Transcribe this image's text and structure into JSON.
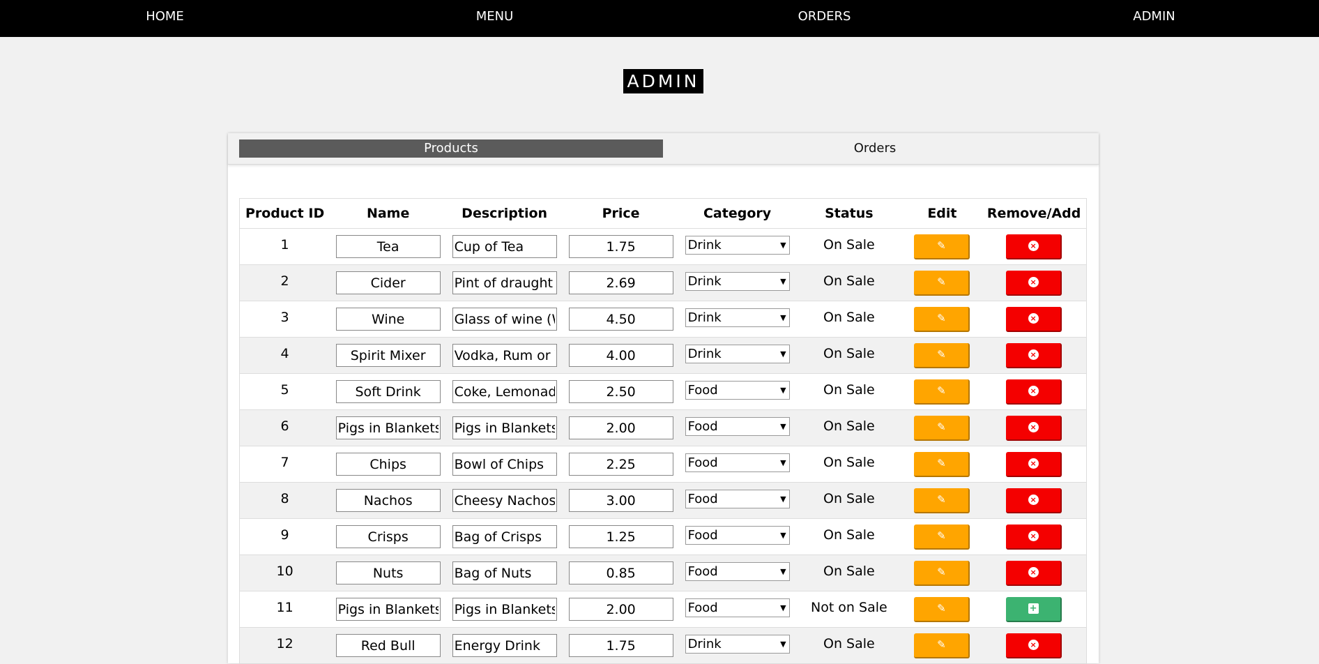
{
  "nav": {
    "home": "HOME",
    "menu": "MENU",
    "orders": "ORDERS",
    "admin": "ADMIN"
  },
  "page": {
    "title": "ADMIN"
  },
  "tabs": {
    "products": "Products",
    "orders": "Orders"
  },
  "table": {
    "headers": [
      "Product ID",
      "Name",
      "Description",
      "Price",
      "Category",
      "Status",
      "Edit",
      "Remove/Add"
    ],
    "rows": [
      {
        "id": "1",
        "name": "Tea",
        "description": "Cup of Tea",
        "price": "1.75",
        "category": "Drink",
        "status": "On Sale",
        "action": "remove"
      },
      {
        "id": "2",
        "name": "Cider",
        "description": "Pint of draught c",
        "price": "2.69",
        "category": "Drink",
        "status": "On Sale",
        "action": "remove"
      },
      {
        "id": "3",
        "name": "Wine",
        "description": "Glass of wine (W",
        "price": "4.50",
        "category": "Drink",
        "status": "On Sale",
        "action": "remove"
      },
      {
        "id": "4",
        "name": "Spirit Mixer",
        "description": "Vodka, Rum or V",
        "price": "4.00",
        "category": "Drink",
        "status": "On Sale",
        "action": "remove"
      },
      {
        "id": "5",
        "name": "Soft Drink",
        "description": "Coke, Lemonade",
        "price": "2.50",
        "category": "Food",
        "status": "On Sale",
        "action": "remove"
      },
      {
        "id": "6",
        "name": "Pigs in Blankets",
        "description": "Pigs in Blankets",
        "price": "2.00",
        "category": "Food",
        "status": "On Sale",
        "action": "remove"
      },
      {
        "id": "7",
        "name": "Chips",
        "description": "Bowl of Chips",
        "price": "2.25",
        "category": "Food",
        "status": "On Sale",
        "action": "remove"
      },
      {
        "id": "8",
        "name": "Nachos",
        "description": "Cheesy Nachos",
        "price": "3.00",
        "category": "Food",
        "status": "On Sale",
        "action": "remove"
      },
      {
        "id": "9",
        "name": "Crisps",
        "description": "Bag of Crisps",
        "price": "1.25",
        "category": "Food",
        "status": "On Sale",
        "action": "remove"
      },
      {
        "id": "10",
        "name": "Nuts",
        "description": "Bag of Nuts",
        "price": "0.85",
        "category": "Food",
        "status": "On Sale",
        "action": "remove"
      },
      {
        "id": "11",
        "name": "Pigs in Blankets",
        "description": "Pigs in Blankets",
        "price": "2.00",
        "category": "Food",
        "status": "Not on Sale",
        "action": "add"
      },
      {
        "id": "12",
        "name": "Red Bull",
        "description": "Energy Drink",
        "price": "1.75",
        "category": "Drink",
        "status": "On Sale",
        "action": "remove"
      }
    ]
  },
  "icons": {
    "edit": "edit-icon",
    "remove": "remove-circle-icon",
    "add": "plus-square-icon"
  },
  "colors": {
    "nav_bg": "#000000",
    "edit_button": "#ffa500",
    "remove_button": "#f40000",
    "add_button": "#3cb371",
    "active_tab": "#5b5b5b"
  }
}
